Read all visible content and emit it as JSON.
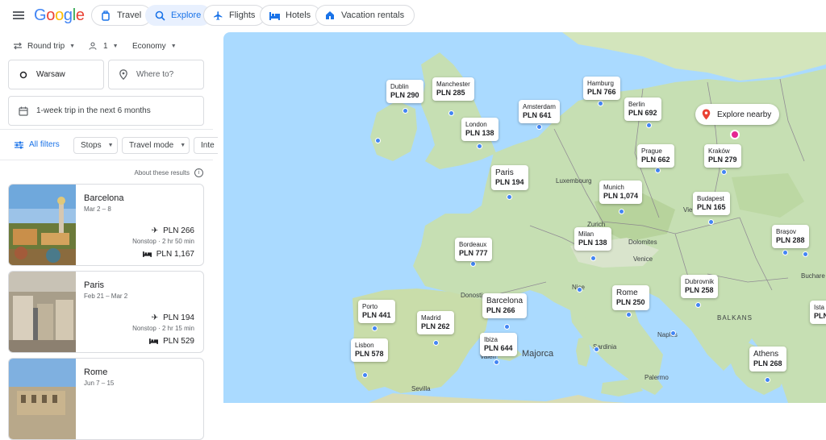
{
  "header": {
    "logo": "Google",
    "tabs": [
      {
        "label": "Travel",
        "icon": "travel-bag-icon"
      },
      {
        "label": "Explore",
        "icon": "explore-icon",
        "active": true
      },
      {
        "label": "Flights",
        "icon": "airplane-icon"
      },
      {
        "label": "Hotels",
        "icon": "bed-icon"
      },
      {
        "label": "Vacation rentals",
        "icon": "house-icon"
      }
    ]
  },
  "search": {
    "trip_type": "Round trip",
    "passengers": "1",
    "cabin": "Economy",
    "origin": "Warsaw",
    "destination_placeholder": "Where to?",
    "dates": "1-week trip in the next 6 months"
  },
  "filters": {
    "all_filters": "All filters",
    "stops": "Stops",
    "travel_mode": "Travel mode",
    "interests": "Inte"
  },
  "results": {
    "about": "About these results",
    "cards": [
      {
        "city": "Barcelona",
        "dates": "Mar 2 – 8",
        "flight_price": "PLN 266",
        "stops": "Nonstop · 2 hr 50 min",
        "hotel_price": "PLN 1,167"
      },
      {
        "city": "Paris",
        "dates": "Feb 21 – Mar 2",
        "flight_price": "PLN 194",
        "stops": "Nonstop · 2 hr 15 min",
        "hotel_price": "PLN 529"
      },
      {
        "city": "Rome",
        "dates": "Jun 7 – 15"
      }
    ]
  },
  "map": {
    "explore_nearby": "Explore nearby",
    "pins": [
      {
        "name": "Dublin",
        "price": "PLN 290"
      },
      {
        "name": "Manchester",
        "price": "PLN 285"
      },
      {
        "name": "London",
        "price": "PLN 138"
      },
      {
        "name": "Amsterdam",
        "price": "PLN 641"
      },
      {
        "name": "Hamburg",
        "price": "PLN 766"
      },
      {
        "name": "Berlin",
        "price": "PLN 692"
      },
      {
        "name": "Paris",
        "price": "PLN 194"
      },
      {
        "name": "Prague",
        "price": "PLN 662"
      },
      {
        "name": "Kraków",
        "price": "PLN 279"
      },
      {
        "name": "Munich",
        "price": "PLN 1,074"
      },
      {
        "name": "Budapest",
        "price": "PLN 165"
      },
      {
        "name": "Milan",
        "price": "PLN 138"
      },
      {
        "name": "Bordeaux",
        "price": "PLN 777"
      },
      {
        "name": "Brașov",
        "price": "PLN 288"
      },
      {
        "name": "Dubrovnik",
        "price": "PLN 258"
      },
      {
        "name": "Rome",
        "price": "PLN 250"
      },
      {
        "name": "Barcelona",
        "price": "PLN 266"
      },
      {
        "name": "Porto",
        "price": "PLN 441"
      },
      {
        "name": "Madrid",
        "price": "PLN 262"
      },
      {
        "name": "Ibiza",
        "price": "PLN 644"
      },
      {
        "name": "Lisbon",
        "price": "PLN 578"
      },
      {
        "name": "Athens",
        "price": "PLN 268"
      },
      {
        "name": "Ista",
        "price": "PLN"
      }
    ],
    "labels": {
      "luxembourg": "Luxembourg",
      "zurich": "Zurich",
      "dolomites": "Dolomites",
      "venice": "Venice",
      "nice": "Nice",
      "donostia": "Donostia",
      "naples": "Naples",
      "sardinia": "Sardinia",
      "palermo": "Palermo",
      "sevilla": "Sevilla",
      "valencia": "Valen",
      "balkans": "BALKANS",
      "bucharest": "Buchare",
      "vienna": "Vie",
      "majorca": "Majorca"
    }
  }
}
